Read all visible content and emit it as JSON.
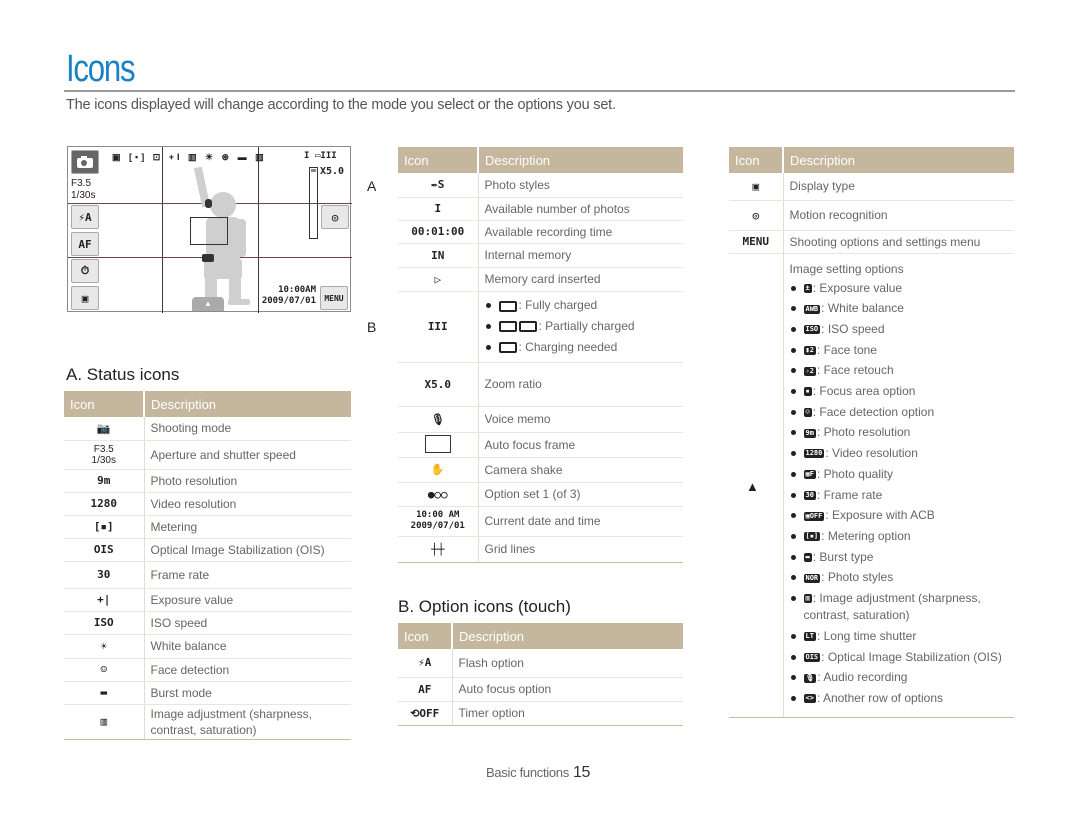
{
  "header": {
    "title": "Icons",
    "intro": "The icons displayed will change according to the mode you select or the options you set."
  },
  "screen": {
    "aperture": "F3.5",
    "shutter": "1/30s",
    "flash_btn": "⚡A",
    "af_btn": "AF",
    "timer_btn": "⏱",
    "display_btn": "▣",
    "shots_left": "I",
    "zoom_ratio": "X5.0",
    "time": "10:00AM",
    "date": "2009/07/01",
    "menu_btn": "MENU",
    "motion_btn": "◎",
    "tab_btn": "▲",
    "top_icons": "▣ [▪] ⊡ +I  ▥ ☀ ⊛ ▬ ▥",
    "battery": "▭III"
  },
  "markers": {
    "a": "A",
    "b": "B",
    "up": "▲"
  },
  "status": {
    "title": "A. Status icons",
    "header_icon": "Icon",
    "header_desc": "Description",
    "rows": [
      {
        "icon": "camera-p-icon",
        "glyph": "📷",
        "desc": "Shooting mode"
      },
      {
        "icon": "aperture-shutter",
        "glyph": "F3.5\n1/30s",
        "desc": "Aperture and shutter speed"
      },
      {
        "icon": "photo-resolution-icon",
        "glyph": "9m",
        "desc": "Photo resolution"
      },
      {
        "icon": "video-resolution-icon",
        "glyph": "1280",
        "desc": "Video resolution"
      },
      {
        "icon": "metering-icon",
        "glyph": "[▪]",
        "desc": "Metering"
      },
      {
        "icon": "ois-icon",
        "glyph": "OIS",
        "desc": "Optical Image Stabilization (OIS)"
      },
      {
        "icon": "frame-rate-icon",
        "glyph": "30",
        "desc": "Frame rate"
      },
      {
        "icon": "exposure-value-icon",
        "glyph": "+|",
        "desc": "Exposure value"
      },
      {
        "icon": "iso-icon",
        "glyph": "ISO",
        "desc": "ISO speed"
      },
      {
        "icon": "white-balance-icon",
        "glyph": "☀",
        "desc": "White balance"
      },
      {
        "icon": "face-detection-icon",
        "glyph": "☺",
        "desc": "Face detection"
      },
      {
        "icon": "burst-icon",
        "glyph": "▬",
        "desc": "Burst mode"
      },
      {
        "icon": "image-adjust-icon",
        "glyph": "▥",
        "desc": "Image adjustment (sharpness, contrast, saturation)"
      }
    ]
  },
  "middle": {
    "header_icon": "Icon",
    "header_desc": "Description",
    "rows": [
      {
        "icon": "photo-styles-icon",
        "glyph": "✒S",
        "desc": "Photo styles"
      },
      {
        "icon": "photo-count-icon",
        "glyph": "I",
        "desc": "Available number of photos"
      },
      {
        "icon": "recording-time-icon",
        "glyph": "00:01:00",
        "desc": "Available recording time"
      },
      {
        "icon": "internal-memory-icon",
        "glyph": "IN",
        "desc": "Internal memory"
      },
      {
        "icon": "memory-card-icon",
        "glyph": "▷",
        "desc": "Memory card inserted"
      },
      {
        "icon": "battery-icon",
        "glyph": "III",
        "desc": "",
        "bullets": [
          ": Fully charged",
          ": Partially charged",
          ": Charging needed"
        ]
      },
      {
        "icon": "zoom-ratio-icon",
        "glyph": "X5.0",
        "desc": "Zoom ratio"
      },
      {
        "icon": "voice-memo-icon",
        "glyph": "🎙",
        "desc": "Voice memo"
      },
      {
        "icon": "af-frame-icon",
        "glyph": "",
        "desc": "Auto focus frame"
      },
      {
        "icon": "camera-shake-icon",
        "glyph": "✋",
        "desc": "Camera shake"
      },
      {
        "icon": "option-set-icon",
        "glyph": "●○○",
        "desc": "Option set 1 (of 3)"
      },
      {
        "icon": "date-time-icon",
        "glyph": "10:00 AM\n2009/07/01",
        "desc": "Current date and time"
      },
      {
        "icon": "grid-lines-icon",
        "glyph": "┼┼",
        "desc": "Grid lines"
      }
    ]
  },
  "touch": {
    "title": "B. Option icons (touch)",
    "header_icon": "Icon",
    "header_desc": "Description",
    "rows": [
      {
        "icon": "flash-icon",
        "glyph": "⚡A",
        "desc": "Flash option"
      },
      {
        "icon": "af-icon",
        "glyph": "AF",
        "desc": "Auto focus option"
      },
      {
        "icon": "timer-icon",
        "glyph": "⟲OFF",
        "desc": "Timer option"
      }
    ]
  },
  "right": {
    "header_icon": "Icon",
    "header_desc": "Description",
    "rows": [
      {
        "icon": "display-type-icon",
        "glyph": "▣",
        "desc": "Display type"
      },
      {
        "icon": "motion-recognition-icon",
        "glyph": "◎",
        "desc": "Motion recognition"
      },
      {
        "icon": "menu-icon",
        "glyph": "MENU",
        "desc": "Shooting options and settings menu"
      }
    ],
    "image_settings": {
      "title": "Image setting options",
      "items": [
        {
          "icon": "exposure-icon",
          "glyph": "±",
          "label": ": Exposure value"
        },
        {
          "icon": "awb-icon",
          "glyph": "AWB",
          "label": ": White balance"
        },
        {
          "icon": "iso-auto-icon",
          "glyph": "ISO",
          "label": ": ISO speed"
        },
        {
          "icon": "face-tone-icon",
          "glyph": "▮2",
          "label": ": Face tone"
        },
        {
          "icon": "face-retouch-icon",
          "glyph": "✧2",
          "label": ": Face retouch"
        },
        {
          "icon": "focus-area-icon",
          "glyph": "▪",
          "label": ": Focus area option"
        },
        {
          "icon": "face-detection-off-icon",
          "glyph": "☺",
          "label": ": Face detection option"
        },
        {
          "icon": "photo-resolution-icon",
          "glyph": "9m",
          "label": ": Photo resolution"
        },
        {
          "icon": "video-resolution-icon",
          "glyph": "1280",
          "label": ": Video resolution"
        },
        {
          "icon": "photo-quality-icon",
          "glyph": "▦F",
          "label": ": Photo quality"
        },
        {
          "icon": "frame-rate-icon",
          "glyph": "30",
          "label": ": Frame rate"
        },
        {
          "icon": "acb-icon",
          "glyph": "▣OFF",
          "label": ": Exposure with ACB"
        },
        {
          "icon": "metering-icon",
          "glyph": "[▪]",
          "label": ": Metering option"
        },
        {
          "icon": "burst-type-icon",
          "glyph": "▬",
          "label": ": Burst type"
        },
        {
          "icon": "photo-styles-nor-icon",
          "glyph": "NOR",
          "label": ": Photo styles"
        },
        {
          "icon": "image-adjust-icon",
          "glyph": "▥",
          "label": ": Image adjustment (sharpness, contrast, saturation)"
        },
        {
          "icon": "long-time-shutter-icon",
          "glyph": "LT",
          "label": ": Long time shutter"
        },
        {
          "icon": "ois-icon",
          "glyph": "OIS",
          "label": ": Optical Image Stabilization (OIS)"
        },
        {
          "icon": "audio-recording-icon",
          "glyph": "🎙",
          "label": ": Audio recording"
        },
        {
          "icon": "another-row-icon",
          "glyph": "<>",
          "label": ": Another row of options"
        }
      ]
    }
  },
  "footer": {
    "section": "Basic functions",
    "page": "15"
  }
}
